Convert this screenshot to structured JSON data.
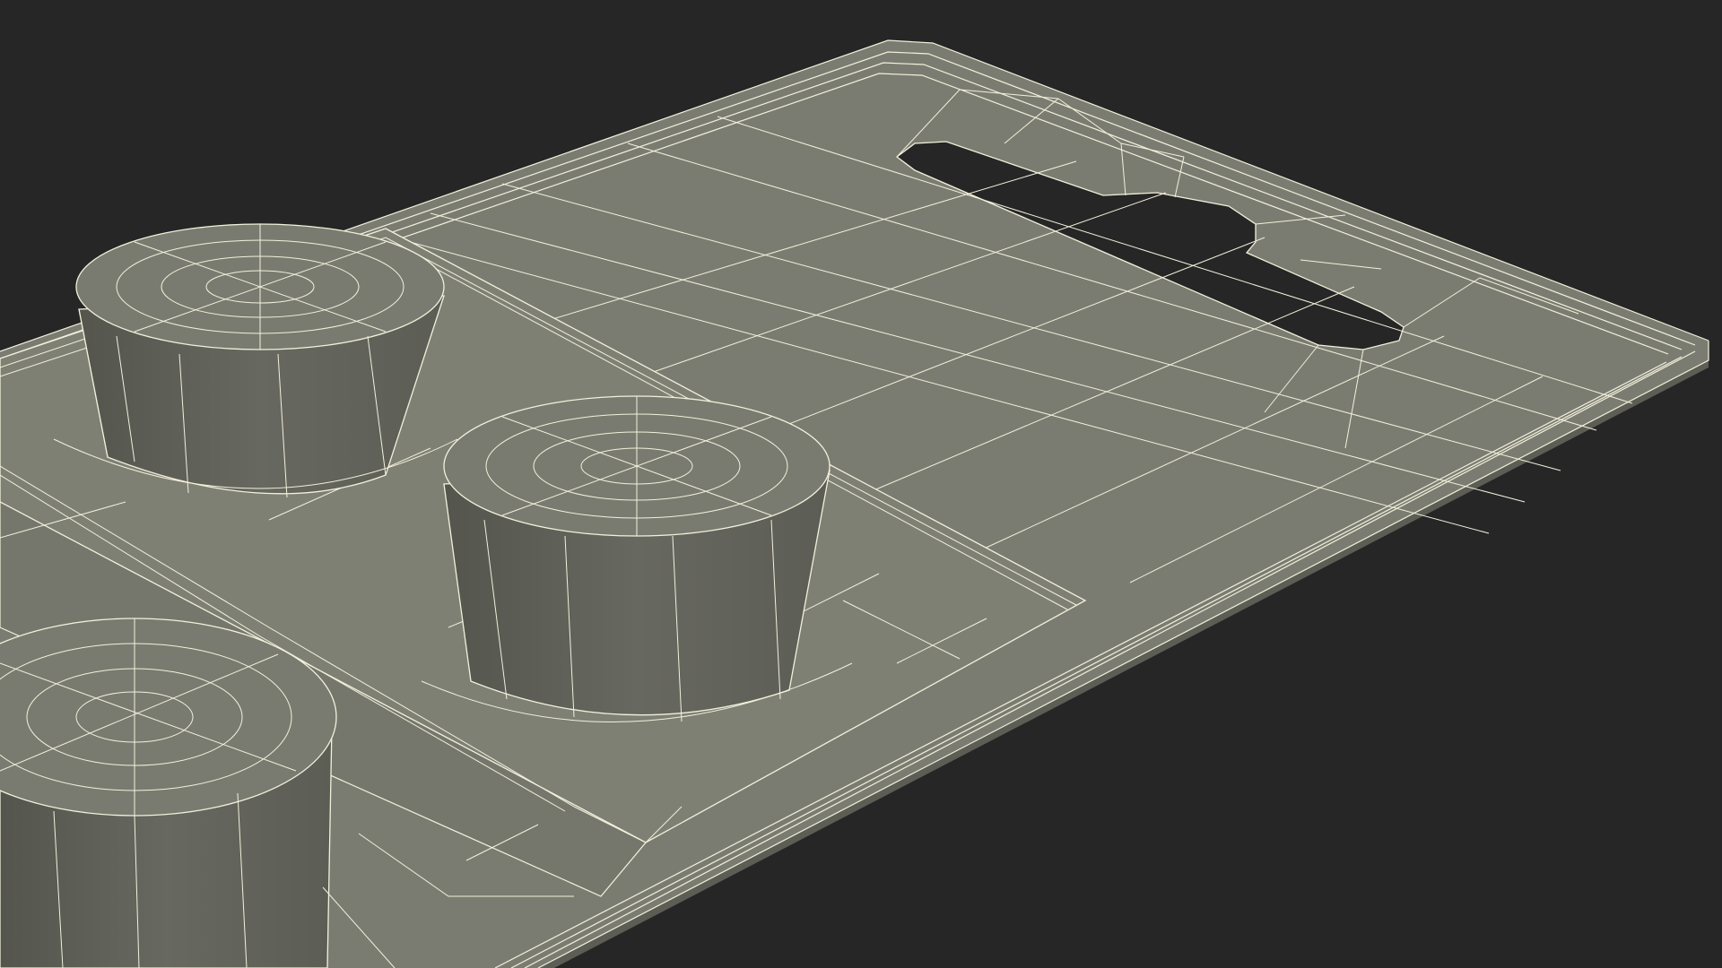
{
  "scene": {
    "subject": "wireframe-3d-blister-tray",
    "colors": {
      "background": "#262626",
      "surface": "#7a7b70",
      "surface_light": "#868779",
      "surface_dark": "#5f6057",
      "cylinder_side": "#626359",
      "cylinder_shadow": "#54554d",
      "wire": "#f2f1dc"
    }
  }
}
